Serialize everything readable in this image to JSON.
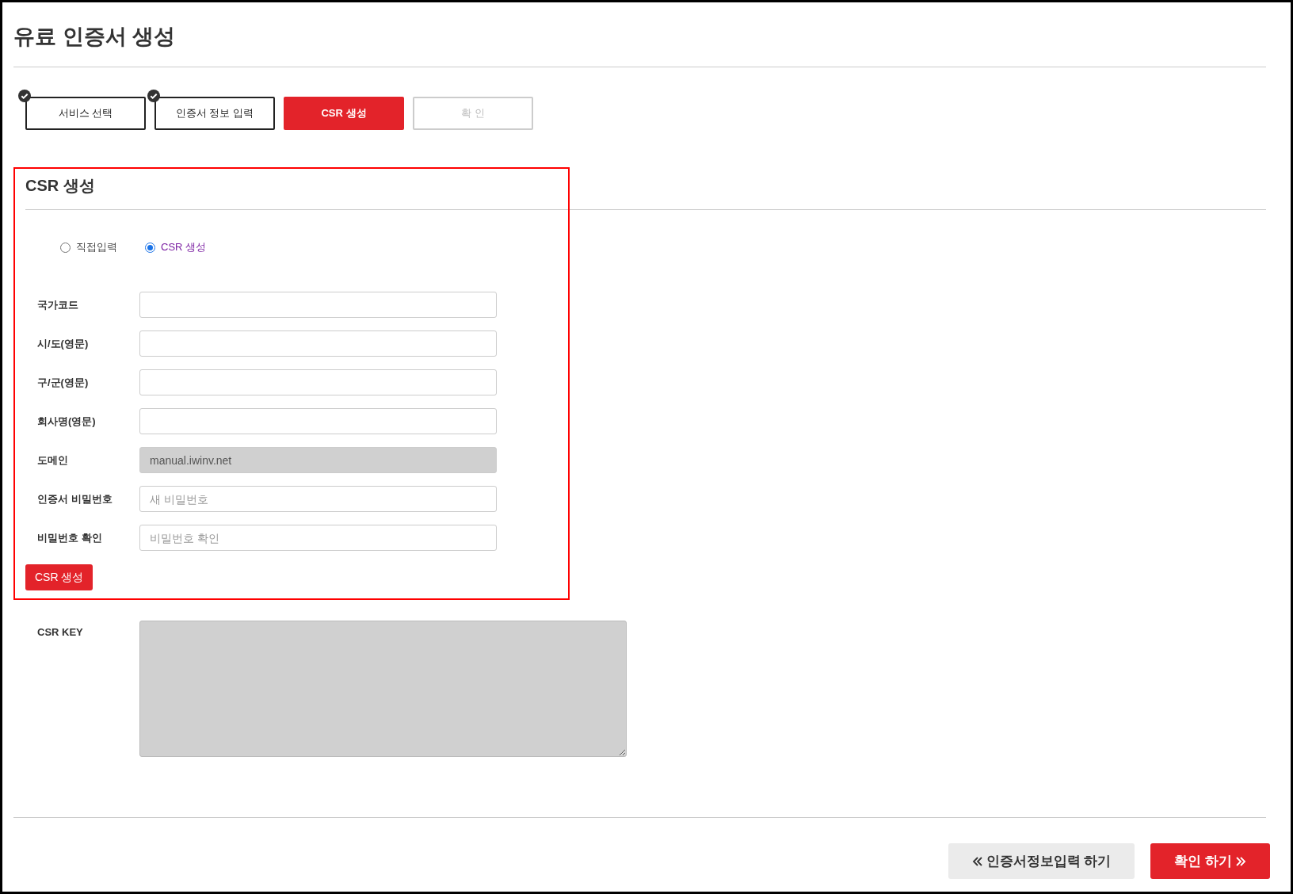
{
  "title": "유료 인증서 생성",
  "steps": [
    {
      "label": "서비스 선택",
      "done": true,
      "selected": false,
      "disabled": false
    },
    {
      "label": "인증서 정보 입력",
      "done": true,
      "selected": false,
      "disabled": false
    },
    {
      "label": "CSR 생성",
      "done": false,
      "selected": true,
      "disabled": false
    },
    {
      "label": "확 인",
      "done": false,
      "selected": false,
      "disabled": true
    }
  ],
  "section": {
    "title": "CSR 생성",
    "highlighted": true,
    "radios": [
      {
        "label": "직접입력",
        "selected": false
      },
      {
        "label": "CSR 생성",
        "selected": true
      }
    ],
    "fields": [
      {
        "label": "국가코드",
        "disabled": false
      },
      {
        "label": "시/도(영문)",
        "disabled": false
      },
      {
        "label": "구/군(영문)",
        "disabled": false
      },
      {
        "label": "회사명(영문)",
        "disabled": false
      },
      {
        "label": "도메인",
        "value": "manual.iwinv.net",
        "disabled": true
      },
      {
        "label": "인증서 비밀번호",
        "placeholder": "새 비밀번호",
        "disabled": false
      },
      {
        "label": "비밀번호 확인",
        "placeholder": "비밀번호 확인",
        "disabled": false
      }
    ],
    "button": "CSR 생성"
  },
  "csr_key": {
    "label": "CSR KEY",
    "disabled": true
  },
  "footer_buttons": [
    {
      "label": "인증서정보입력 하기",
      "kind": "prev"
    },
    {
      "label": "확인 하기",
      "kind": "next"
    }
  ]
}
